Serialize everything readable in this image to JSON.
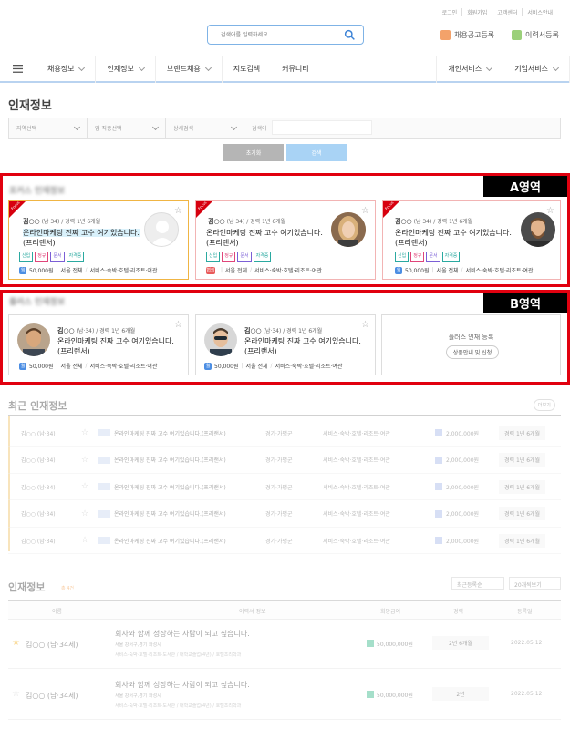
{
  "top_links": [
    "로그인",
    "회원가입",
    "고객센터",
    "서비스안내"
  ],
  "search": {
    "placeholder": "검색어를 입력하세요"
  },
  "header_buttons": {
    "job_post": "채용공고등록",
    "resume": "이력서등록"
  },
  "nav": {
    "left": [
      "채용정보",
      "인재정보",
      "브랜드채용",
      "지도검색",
      "커뮤니티"
    ],
    "right": [
      "개인서비스",
      "기업서비스"
    ]
  },
  "page_title": "인재정보",
  "filters": {
    "region": "지역선택",
    "job": "업·직종선택",
    "detail": "상세검색",
    "keyword_label": "검색어",
    "reset": "초기화",
    "search": "검색"
  },
  "zone_a": {
    "tag": "A영역",
    "section_title": "포커스 인재정보",
    "cards": [
      {
        "ribbon": "Focus",
        "name": "김○○",
        "meta": "(남·34) / 경력 1년 6개월",
        "title": "온라인마케팅 진짜 고수 여기있습니다.",
        "subtitle": "(프리랜서)",
        "tags": [
          "신입",
          "정규",
          "문서",
          "자격증"
        ],
        "pay_label": "월",
        "pay": "50,000원",
        "area": "서울 전체",
        "field": "서비스·숙박·호텔·리조트·여관",
        "starred": false
      },
      {
        "ribbon": "Focus",
        "name": "김○○",
        "meta": "(남·34) / 경력 1년 6개월",
        "title": "온라인마케팅 진짜 고수 여기있습니다.",
        "subtitle": "(프리랜서)",
        "tags": [
          "신입",
          "정규",
          "문서",
          "자격증"
        ],
        "pay_label": "협의",
        "pay": "",
        "area": "서울 전체",
        "field": "서비스·숙박·호텔·리조트·여관",
        "starred": false
      },
      {
        "ribbon": "Focus",
        "name": "김○○",
        "meta": "(남·34) / 경력 1년 6개월",
        "title": "온라인마케팅 진짜 고수 여기있습니다.",
        "subtitle": "(프리랜서)",
        "tags": [
          "신입",
          "정규",
          "문서",
          "자격증"
        ],
        "pay_label": "월",
        "pay": "50,000원",
        "area": "서울 전체",
        "field": "서비스·숙박·호텔·리조트·여관",
        "starred": false
      }
    ]
  },
  "zone_b": {
    "tag": "B영역",
    "section_title": "플러스 인재정보",
    "cards": [
      {
        "name": "김○○",
        "meta": "(남·34) / 경력 1년 6개월",
        "title": "온라인마케팅 진짜 고수 여기있습니다.",
        "subtitle": "(프리랜서)",
        "pay_label": "월",
        "pay": "50,000원",
        "area": "서울 전체",
        "field": "서비스·숙박·호텔·리조트·여관"
      },
      {
        "name": "김○○",
        "meta": "(남·34) / 경력 1년 6개월",
        "title": "온라인마케팅 진짜 고수 여기있습니다.",
        "subtitle": "(프리랜서)",
        "pay_label": "월",
        "pay": "50,000원",
        "area": "서울 전체",
        "field": "서비스·숙박·호텔·리조트·여관"
      }
    ],
    "empty": {
      "title": "플러스 인재 등록",
      "button": "상품안내 및 신청"
    }
  },
  "recent": {
    "title": "최근 인재정보",
    "more": "더보기",
    "rows": [
      {
        "name": "김○○ (남·34)",
        "title": "온라인마케팅 진짜 고수 여기있습니다.(프리랜서)",
        "area": "경기·가평군",
        "field": "서비스·숙박·호텔·리조트·여관",
        "pay": "2,000,000원",
        "career": "경력 1년 6개월"
      },
      {
        "name": "김○○ (남·34)",
        "title": "온라인마케팅 진짜 고수 여기있습니다.(프리랜서)",
        "area": "경기·가평군",
        "field": "서비스·숙박·호텔·리조트·여관",
        "pay": "2,000,000원",
        "career": "경력 1년 6개월"
      },
      {
        "name": "김○○ (남·34)",
        "title": "온라인마케팅 진짜 고수 여기있습니다.(프리랜서)",
        "area": "경기·가평군",
        "field": "서비스·숙박·호텔·리조트·여관",
        "pay": "2,000,000원",
        "career": "경력 1년 6개월"
      },
      {
        "name": "김○○ (남·34)",
        "title": "온라인마케팅 진짜 고수 여기있습니다.(프리랜서)",
        "area": "경기·가평군",
        "field": "서비스·숙박·호텔·리조트·여관",
        "pay": "2,000,000원",
        "career": "경력 1년 6개월"
      },
      {
        "name": "김○○ (남·34)",
        "title": "온라인마케팅 진짜 고수 여기있습니다.(프리랜서)",
        "area": "경기·가평군",
        "field": "서비스·숙박·호텔·리조트·여관",
        "pay": "2,000,000원",
        "career": "경력 1년 6개월"
      }
    ]
  },
  "list": {
    "title": "인재정보",
    "count": "총 4건",
    "sort": "최근등록순",
    "per_page": "20개씩보기",
    "headers": [
      "이름",
      "이력서 정보",
      "희망급여",
      "경력",
      "등록일"
    ],
    "rows": [
      {
        "starred": true,
        "name": "김○○ (남·34세)",
        "title": "회사와 함께 성장하는 사람이 되고 싶습니다.",
        "loc": "서울 강서구,경기 화성시",
        "detail": "서비스·숙박·호텔·리조트·도서관 / 대학교졸업(4년) / 호텔조리학과",
        "pay": "50,000,000원",
        "career": "2년 6개월",
        "date": "2022.05.12"
      },
      {
        "starred": false,
        "name": "김○○ (남·34세)",
        "title": "회사와 함께 성장하는 사람이 되고 싶습니다.",
        "loc": "서울 강서구,경기 화성시",
        "detail": "서비스·숙박·호텔·리조트·도서관 / 대학교졸업(4년) / 호텔조리학과",
        "pay": "50,000,000원",
        "career": "2년",
        "date": "2022.05.12"
      }
    ]
  },
  "colors": {
    "accent_red": "#e1000f",
    "brand_blue": "#4c8ee3",
    "gold": "#f0b544"
  }
}
